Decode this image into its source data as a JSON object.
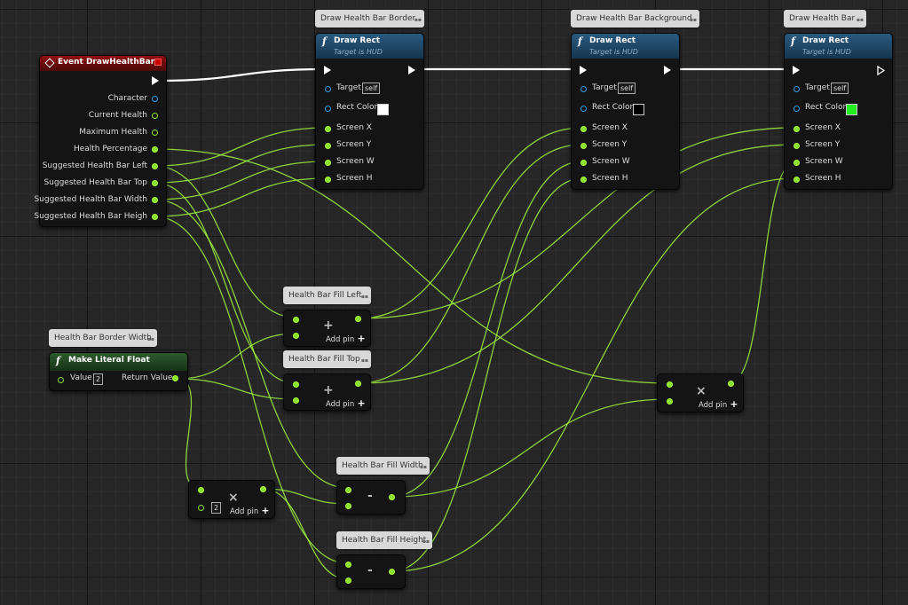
{
  "colors": {
    "float_pin": "#8be02a",
    "object_pin": "#2aa0e6",
    "exec_pin": "#ffffff",
    "wire": "#a0f040",
    "exec_wire": "#ffffff",
    "event_header": "#8e1010",
    "function_header": "#2a5a80"
  },
  "event_node": {
    "title": "Event DrawHealthBar",
    "outputs": [
      "Character",
      "Current Health",
      "Maximum Health",
      "Health Percentage",
      "Suggested Health Bar Left",
      "Suggested Health Bar Top",
      "Suggested Health Bar Width",
      "Suggested Health Bar Heigh"
    ]
  },
  "draw_rects": [
    {
      "comment": "Draw Health Bar Border",
      "title": "Draw Rect",
      "subtitle": "Target is HUD",
      "target_label": "Target",
      "target_value": "self",
      "color_label": "Rect Color",
      "color": "#ffffff",
      "inputs": [
        "Screen X",
        "Screen Y",
        "Screen W",
        "Screen H"
      ]
    },
    {
      "comment": "Draw Health Bar Background",
      "title": "Draw Rect",
      "subtitle": "Target is HUD",
      "target_label": "Target",
      "target_value": "self",
      "color_label": "Rect Color",
      "color": "#000000",
      "inputs": [
        "Screen X",
        "Screen Y",
        "Screen W",
        "Screen H"
      ]
    },
    {
      "comment": "Draw Health Bar",
      "title": "Draw Rect",
      "subtitle": "Target is HUD",
      "target_label": "Target",
      "target_value": "self",
      "color_label": "Rect Color",
      "color": "#22ee22",
      "inputs": [
        "Screen X",
        "Screen Y",
        "Screen W",
        "Screen H"
      ]
    }
  ],
  "literal_node": {
    "comment": "Health Bar Border Width",
    "title": "Make Literal Float",
    "value_label": "Value",
    "value": "2",
    "output_label": "Return Value"
  },
  "add_nodes": [
    {
      "comment": "Health Bar Fill Left",
      "op": "+",
      "add_pin": "Add pin"
    },
    {
      "comment": "Health Bar Fill Top",
      "op": "+",
      "add_pin": "Add pin"
    }
  ],
  "multiply_nodes": [
    {
      "op": "×",
      "add_pin": "Add pin",
      "constant": "2"
    },
    {
      "op": "×",
      "add_pin": "Add pin"
    }
  ],
  "subtract_nodes": [
    {
      "comment": "Health Bar Fill Width",
      "op": "-"
    },
    {
      "comment": "Health Bar Fill Height",
      "op": "-"
    }
  ],
  "icons": {
    "function": "function-f-icon",
    "event": "event-diamond-icon",
    "add": "plus-icon",
    "multiply": "multiply-x-icon",
    "comment_expand": "comment-expand-icon"
  }
}
